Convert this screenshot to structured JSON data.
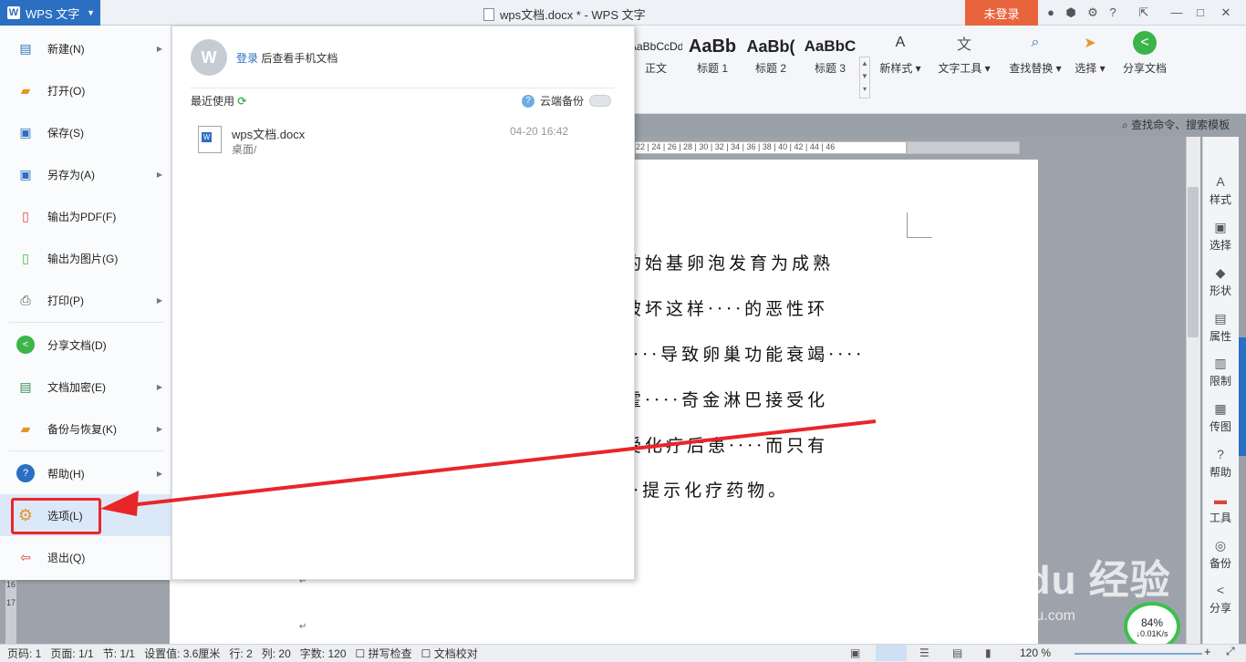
{
  "titlebar": {
    "app_name": "WPS 文字",
    "doc_title": "wps文档.docx * - WPS 文字",
    "login_button": "未登录"
  },
  "ribbon": {
    "styles": [
      {
        "preview": "AaBbCcDd",
        "label": "正文"
      },
      {
        "preview": "AaBb",
        "label": "标题 1"
      },
      {
        "preview": "AaBb(",
        "label": "标题 2"
      },
      {
        "preview": "AaBbC",
        "label": "标题 3"
      }
    ],
    "buttons": {
      "new_style": "新样式",
      "text_tools": "文字工具",
      "find_replace": "查找替换",
      "select": "选择",
      "share_doc": "分享文档"
    },
    "search_command": "查找命令、搜索模板"
  },
  "menu": {
    "items": [
      {
        "label": "新建(N)",
        "has_sub": true,
        "icon": "new-doc-icon"
      },
      {
        "label": "打开(O)",
        "has_sub": false,
        "icon": "folder-open-icon"
      },
      {
        "label": "保存(S)",
        "has_sub": false,
        "icon": "save-icon"
      },
      {
        "label": "另存为(A)",
        "has_sub": true,
        "icon": "save-as-icon"
      },
      {
        "label": "输出为PDF(F)",
        "has_sub": false,
        "icon": "pdf-icon"
      },
      {
        "label": "输出为图片(G)",
        "has_sub": false,
        "icon": "image-icon"
      },
      {
        "label": "打印(P)",
        "has_sub": true,
        "icon": "print-icon"
      },
      {
        "label": "分享文档(D)",
        "has_sub": false,
        "icon": "share-icon"
      },
      {
        "label": "文档加密(E)",
        "has_sub": true,
        "icon": "lock-icon"
      },
      {
        "label": "备份与恢复(K)",
        "has_sub": true,
        "icon": "backup-icon"
      },
      {
        "label": "帮助(H)",
        "has_sub": true,
        "icon": "help-icon"
      },
      {
        "label": "选项(L)",
        "has_sub": false,
        "icon": "gear-icon"
      },
      {
        "label": "退出(Q)",
        "has_sub": false,
        "icon": "exit-icon"
      }
    ]
  },
  "panel": {
    "login_link": "登录",
    "login_suffix": "后查看手机文档",
    "recent_label": "最近使用",
    "cloud_backup": "云端备份",
    "recent_file": {
      "name": "wps文档.docx",
      "path": "桌面/",
      "time": "04-20 16:42"
    }
  },
  "document": {
    "lines": [
      "的始基卵泡发育为成熟",
      "破坏这样····的恶性环",
      "····导致卵巢功能衰竭····",
      "霍····奇金淋巴接受化",
      "受化疗后患····而只有",
      "··提示化疗药物。"
    ]
  },
  "ruler": {
    "ticks": "22 | 24 | 26 | 28 | 30 | 32 | 34 | 36 | 38 | 40 | 42 | 44 | 46"
  },
  "sidepanel": [
    {
      "label": "样式"
    },
    {
      "label": "选择"
    },
    {
      "label": "形状"
    },
    {
      "label": "属性"
    },
    {
      "label": "限制"
    },
    {
      "label": "传图"
    },
    {
      "label": "帮助"
    },
    {
      "label": "工具"
    },
    {
      "label": "备份"
    },
    {
      "label": "分享"
    }
  ],
  "status": {
    "page_no": "页码: 1",
    "pages": "页面: 1/1",
    "section": "节: 1/1",
    "setting": "设置值: 3.6厘米",
    "row": "行: 2",
    "col": "列: 20",
    "words": "字数: 120",
    "spell": "拼写检查",
    "proof": "文档校对",
    "zoom": "120 %"
  },
  "overlay": {
    "speed_percent": "84%",
    "speed_rate": "↓0.01K/s"
  },
  "colors": {
    "accent": "#2b6fc2",
    "login": "#e8643c",
    "highlight_box": "#e8262a"
  }
}
